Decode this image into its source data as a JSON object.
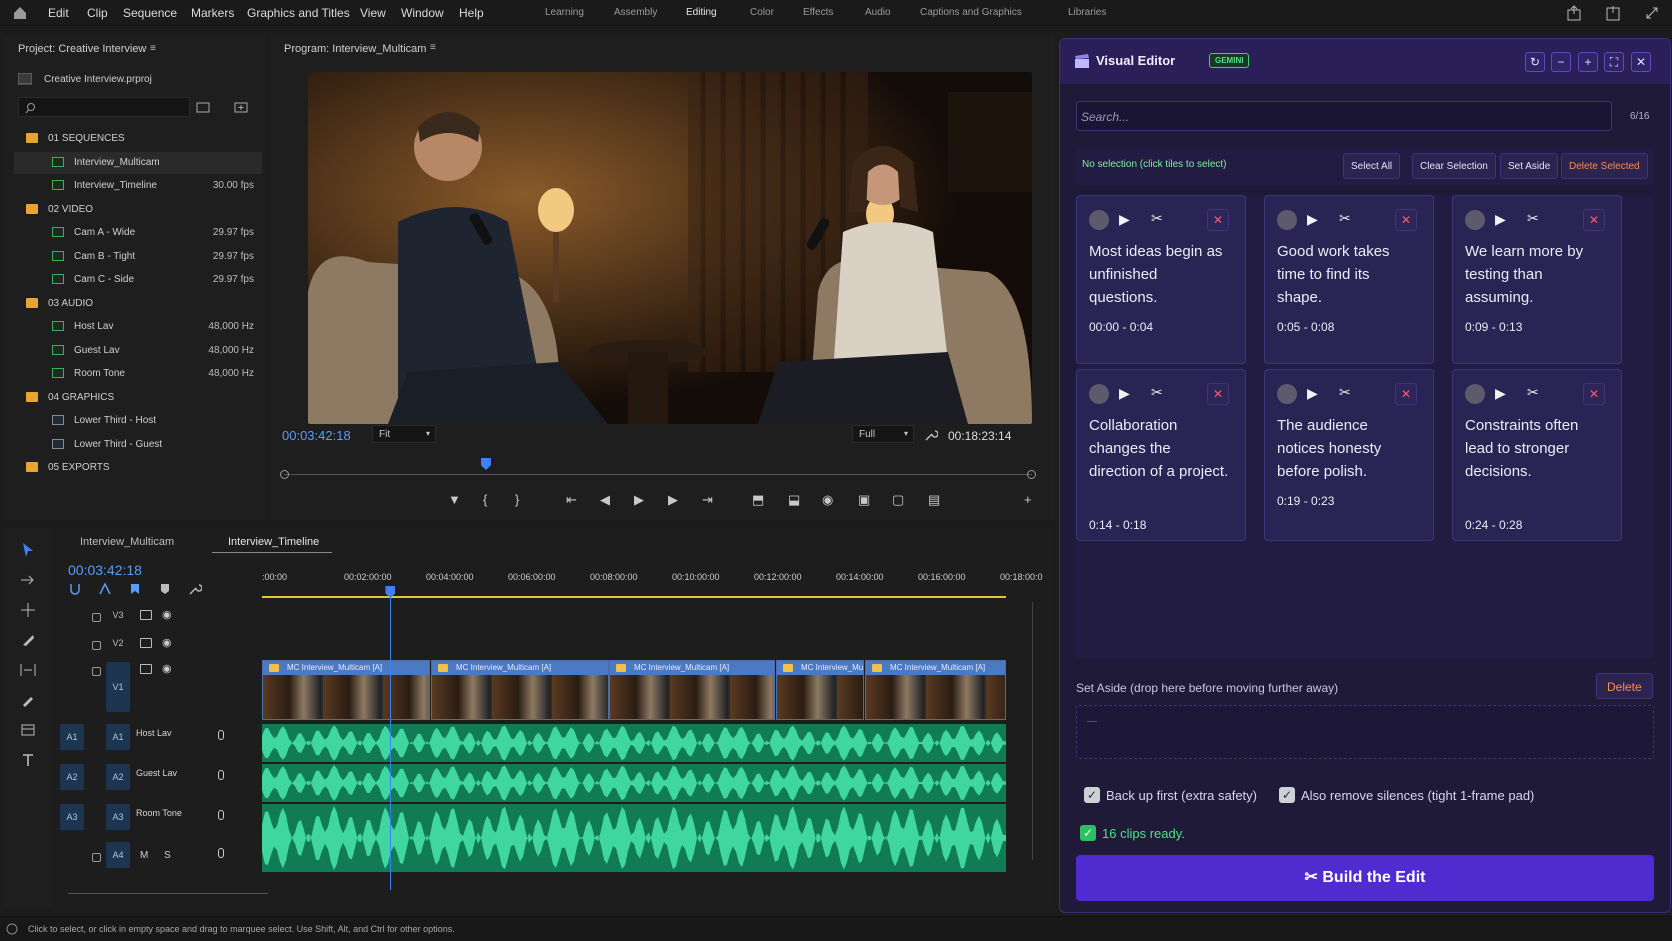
{
  "menubar": {
    "items": [
      "Edit",
      "Clip",
      "Sequence",
      "Markers",
      "Graphics and Titles",
      "View",
      "Window",
      "Help"
    ],
    "workspaces": [
      "Learning",
      "Assembly",
      "Editing",
      "Color",
      "Effects",
      "Audio",
      "Captions and Graphics",
      "Libraries"
    ],
    "active_workspace": "Editing"
  },
  "project": {
    "title": "Project: Creative Interview",
    "file": "Creative Interview.prproj",
    "search_placeholder": "",
    "items": [
      {
        "type": "folder",
        "label": "01 SEQUENCES",
        "value": ""
      },
      {
        "type": "seq",
        "label": "Interview_Multicam",
        "value": ""
      },
      {
        "type": "seq",
        "label": "Interview_Timeline",
        "value": "30.00 fps"
      },
      {
        "type": "folder",
        "label": "02 VIDEO",
        "value": ""
      },
      {
        "type": "clip",
        "label": "Cam A - Wide",
        "value": "29.97 fps"
      },
      {
        "type": "clip",
        "label": "Cam B - Tight",
        "value": "29.97 fps"
      },
      {
        "type": "clip",
        "label": "Cam C - Side",
        "value": "29.97 fps"
      },
      {
        "type": "folder",
        "label": "03 AUDIO",
        "value": ""
      },
      {
        "type": "clip",
        "label": "Host Lav",
        "value": "48,000 Hz"
      },
      {
        "type": "clip",
        "label": "Guest Lav",
        "value": "48,000 Hz"
      },
      {
        "type": "clip",
        "label": "Room Tone",
        "value": "48,000 Hz"
      },
      {
        "type": "folder",
        "label": "04 GRAPHICS",
        "value": ""
      },
      {
        "type": "gfx",
        "label": "Lower Third - Host",
        "value": ""
      },
      {
        "type": "gfx",
        "label": "Lower Third - Guest",
        "value": ""
      },
      {
        "type": "folder",
        "label": "05 EXPORTS",
        "value": ""
      }
    ]
  },
  "program": {
    "title": "Program: Interview_Multicam",
    "timecode": "00:03:42:18",
    "fit": "Fit",
    "quality": "Full",
    "duration": "00:18:23:14",
    "playhead_fraction": 0.27
  },
  "timeline": {
    "tabs": [
      "Interview_Multicam",
      "Interview_Timeline"
    ],
    "active_tab": "Interview_Timeline",
    "timecode": "00:03:42:18",
    "ruler": [
      ":00:00",
      "00:02:00:00",
      "00:04:00:00",
      "00:06:00:00",
      "00:08:00:00",
      "00:10:00:00",
      "00:12:00:00",
      "00:14:00:00",
      "00:16:00:00",
      "00:18:00:0"
    ],
    "video_tracks": [
      "V3",
      "V2",
      "V1"
    ],
    "audio_tracks": [
      {
        "src": "A1",
        "tgt": "A1",
        "name": "Host Lav"
      },
      {
        "src": "A2",
        "tgt": "A2",
        "name": "Guest Lav"
      },
      {
        "src": "A3",
        "tgt": "A3",
        "name": "Room Tone"
      },
      {
        "src": "",
        "tgt": "A4",
        "name": ""
      }
    ],
    "a4_m": "M",
    "a4_s": "S",
    "clips": [
      "MC Interview_Multicam [A]",
      "MC Interview_Multicam [A]",
      "MC Interview_Multicam [A]",
      "MC Interview_Mu",
      "MC Interview_Multicam [A]"
    ]
  },
  "ve": {
    "title": "Visual Editor",
    "badge": "GEMINI",
    "search_placeholder": "Search...",
    "count": "6/16",
    "selection_status": "No selection (click tiles to select)",
    "select_all": "Select All",
    "clear_selection": "Clear Selection",
    "set_aside": "Set Aside",
    "delete_selected": "Delete Selected",
    "tiles": [
      {
        "text": "Most ideas begin as unfinished questions.",
        "time": "00:00 - 0:04"
      },
      {
        "text": "Good work takes time to find its shape.",
        "time": "0:05 - 0:08"
      },
      {
        "text": "We learn more by testing than assuming.",
        "time": "0:09 - 0:13"
      },
      {
        "text": "Collaboration changes the direction of a project.",
        "time": "0:14 - 0:18"
      },
      {
        "text": "The audience notices honesty before polish.",
        "time": "0:19 - 0:23"
      },
      {
        "text": "Constraints often lead to stronger decisions.",
        "time": "0:24 - 0:28"
      }
    ],
    "aside_label": "Set Aside (drop here before moving further away)",
    "aside_delete": "Delete",
    "aside_empty": "—",
    "opt_backup": "Back up first (extra safety)",
    "opt_silences": "Also remove silences (tight 1-frame pad)",
    "ready": "16 clips ready.",
    "build": "Build the Edit",
    "colors": {
      "accent": "#4f2bd0",
      "panel": "#201a39",
      "tile": "#2a2454",
      "delete": "#ff7a45",
      "ready": "#3fd07a"
    }
  },
  "status": "Click to select, or click in empty space and drag to marquee select. Use Shift, Alt, and Ctrl for other options."
}
